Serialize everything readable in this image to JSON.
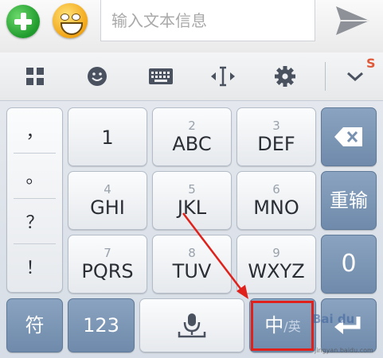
{
  "compose": {
    "add_icon": "plus-circle-icon",
    "emoji_icon": "smiley-face-icon",
    "input_placeholder": "输入文本信息",
    "input_value": "",
    "send_icon": "send-arrow-icon"
  },
  "toolbar": {
    "icons": [
      "grid-icon",
      "emoji-icon",
      "keyboard-icon",
      "cursor-move-icon",
      "settings-icon",
      "chevron-down-icon"
    ]
  },
  "keyboard": {
    "punctuation": [
      "，",
      "。",
      "？",
      "！"
    ],
    "keys": {
      "k1": {
        "num": "",
        "main": "1"
      },
      "k2": {
        "num": "2",
        "main": "ABC"
      },
      "k3": {
        "num": "3",
        "main": "DEF"
      },
      "k4": {
        "num": "4",
        "main": "GHI"
      },
      "k5": {
        "num": "5",
        "main": "JKL"
      },
      "k6": {
        "num": "6",
        "main": "MNO"
      },
      "k7": {
        "num": "7",
        "main": "PQRS"
      },
      "k8": {
        "num": "8",
        "main": "TUV"
      },
      "k9": {
        "num": "9",
        "main": "WXYZ"
      },
      "zero": {
        "main": "0"
      },
      "reinput": {
        "main": "重输"
      },
      "symbols": {
        "main": "符"
      },
      "numbers": {
        "main": "123"
      },
      "lang_primary": "中",
      "lang_secondary": "/英"
    }
  },
  "watermark": {
    "text": "jingyan.baidu.com",
    "logo": "Baidu"
  },
  "colors": {
    "accent_blue_key": "#7891b1",
    "highlight_red": "#e0201a",
    "add_green": "#2ea83a",
    "emoji_yellow": "#f5b21f"
  }
}
